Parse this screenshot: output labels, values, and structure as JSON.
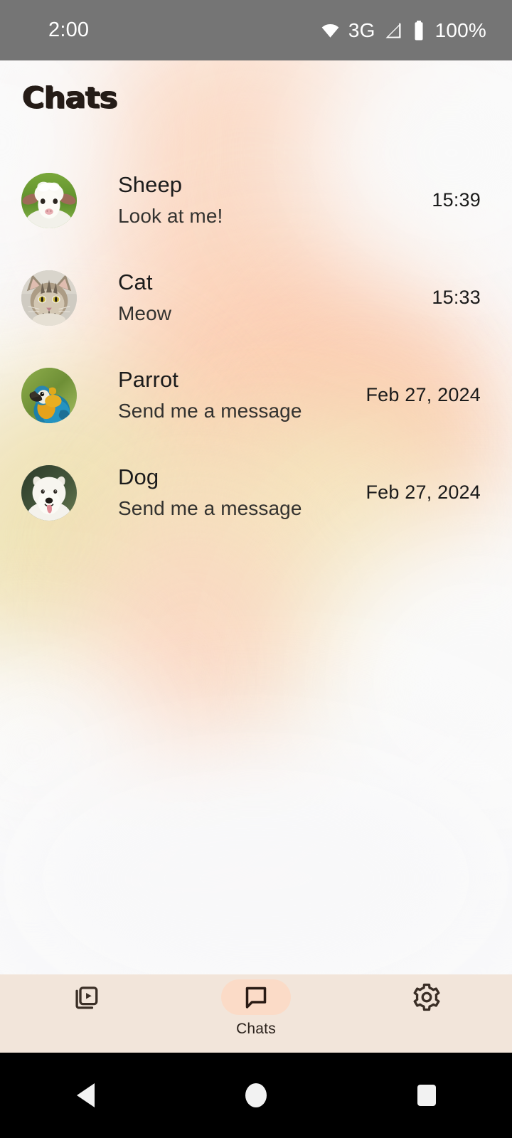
{
  "status_bar": {
    "time": "2:00",
    "network_type": "3G",
    "battery_text": "100%",
    "wifi_icon": "wifi-icon",
    "signal_icon": "cell-signal-icon",
    "battery_icon": "battery-full-icon",
    "background_color": "#757575"
  },
  "header": {
    "title": "Chats"
  },
  "chats": [
    {
      "name": "Sheep",
      "message": "Look at me!",
      "time": "15:39",
      "avatar": "sheep-avatar"
    },
    {
      "name": "Cat",
      "message": "Meow",
      "time": "15:33",
      "avatar": "cat-avatar"
    },
    {
      "name": "Parrot",
      "message": "Send me a message",
      "time": "Feb 27, 2024",
      "avatar": "parrot-avatar"
    },
    {
      "name": "Dog",
      "message": "Send me a message",
      "time": "Feb 27, 2024",
      "avatar": "dog-avatar"
    }
  ],
  "bottom_nav": {
    "items": [
      {
        "label": "",
        "icon": "video-library-icon",
        "active": false
      },
      {
        "label": "Chats",
        "icon": "chat-bubble-icon",
        "active": true
      },
      {
        "label": "",
        "icon": "gear-icon",
        "active": false
      }
    ],
    "background_color": "#F2E5DA",
    "active_pill_color": "#FBDBC7",
    "icon_color": "#3A2E26"
  },
  "android_nav": {
    "back": "back-triangle-icon",
    "home": "home-circle-icon",
    "recents": "recents-square-icon",
    "background_color": "#000000"
  },
  "theme": {
    "page_background": "#F9F9FA",
    "accent_peach": "#FBD9C4",
    "accent_yellow": "#EFE2B4",
    "text_primary": "#1B1B1B",
    "text_secondary": "#33322F"
  }
}
